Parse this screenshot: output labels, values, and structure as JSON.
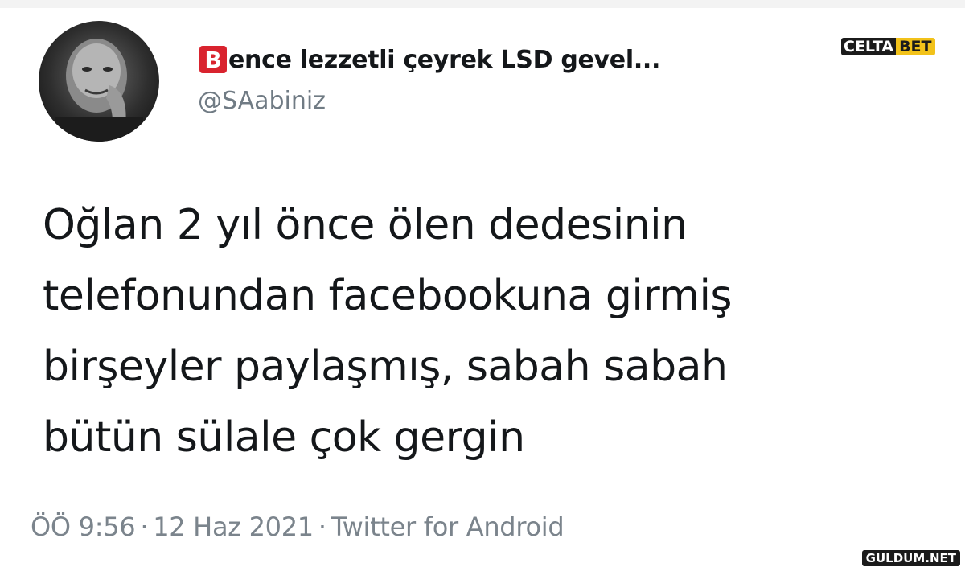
{
  "tweet": {
    "author": {
      "badge_letter": "B",
      "display_name_rest": "ence lezzetli çeyrek LSD gevel...",
      "handle": "@SAabiniz"
    },
    "lines": [
      "Oğlan 2 yıl önce ölen dedesinin",
      "telefonundan facebookuna girmiş",
      "birşeyler paylaşmış, sabah sabah",
      "bütün sülale çok gergin"
    ],
    "time": "ÖÖ 9:56",
    "separator": "·",
    "date": "12 Haz 2021",
    "source": "Twitter for Android"
  },
  "watermarks": {
    "top_part1": "CELTA",
    "top_part2": "BET",
    "bottom": "GULDUM.NET"
  },
  "colors": {
    "badge": "#d9232e",
    "text": "#14171a",
    "muted": "#707b84",
    "watermark_accent": "#f2c21a"
  }
}
